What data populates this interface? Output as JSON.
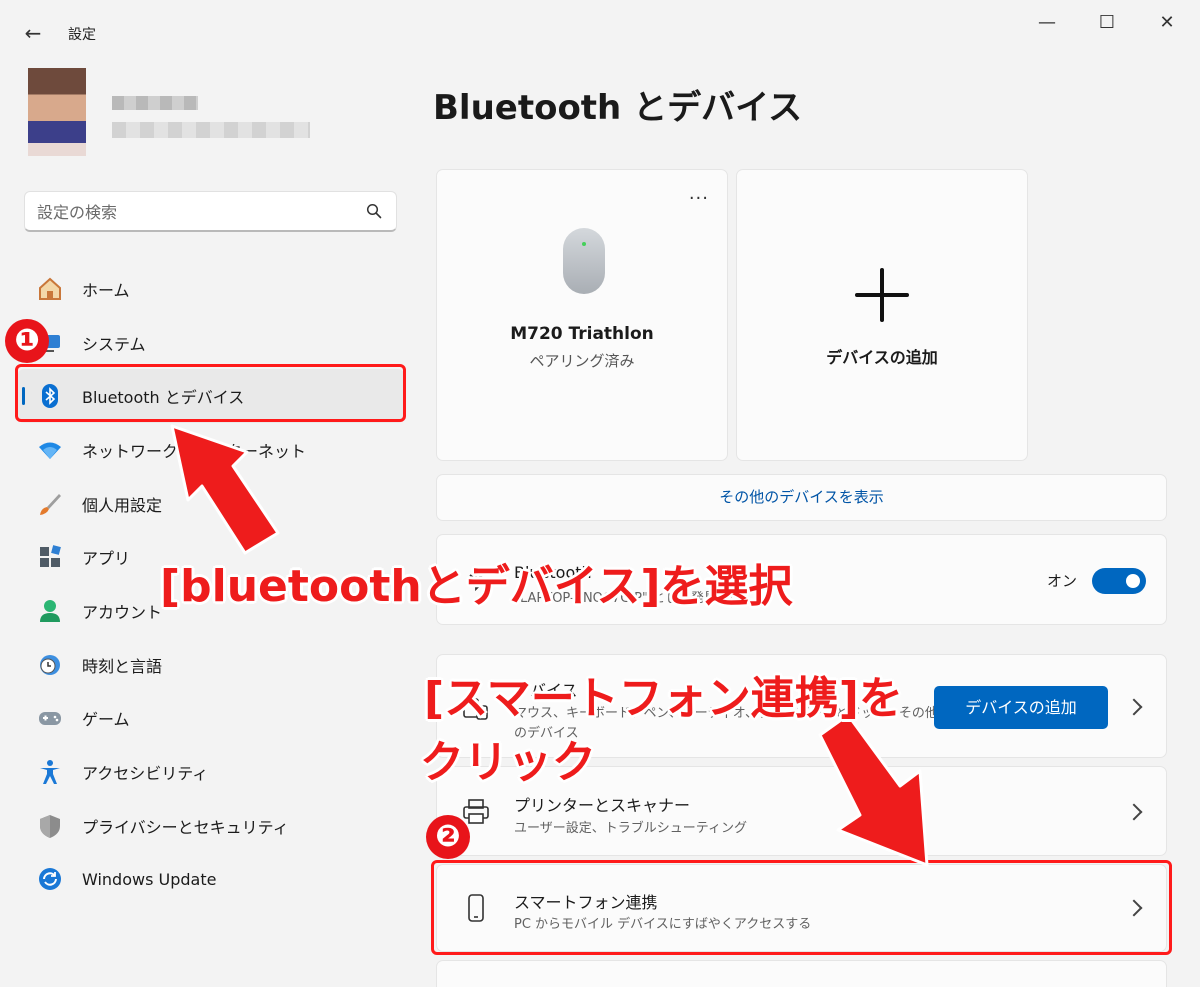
{
  "window": {
    "back_glyph": "←",
    "title": "設定",
    "minimize_glyph": "—",
    "maximize_glyph": "☐",
    "close_glyph": "✕"
  },
  "search": {
    "placeholder": "設定の検索"
  },
  "sidebar": {
    "items": [
      {
        "label": "ホーム",
        "icon": "home-icon"
      },
      {
        "label": "システム",
        "icon": "system-icon"
      },
      {
        "label": "Bluetooth とデバイス",
        "icon": "bluetooth-icon",
        "active": true
      },
      {
        "label": "ネットワークとインターネット",
        "icon": "wifi-icon"
      },
      {
        "label": "個人用設定",
        "icon": "brush-icon"
      },
      {
        "label": "アプリ",
        "icon": "apps-icon"
      },
      {
        "label": "アカウント",
        "icon": "account-icon"
      },
      {
        "label": "時刻と言語",
        "icon": "clock-globe-icon"
      },
      {
        "label": "ゲーム",
        "icon": "gamepad-icon"
      },
      {
        "label": "アクセシビリティ",
        "icon": "accessibility-icon"
      },
      {
        "label": "プライバシーとセキュリティ",
        "icon": "shield-icon"
      },
      {
        "label": "Windows Update",
        "icon": "update-icon"
      }
    ]
  },
  "main": {
    "title": "Bluetooth とデバイス",
    "device_card": {
      "more_glyph": "···",
      "name": "M720 Triathlon",
      "status": "ペアリング済み",
      "icon": "mouse-icon"
    },
    "add_card": {
      "label": "デバイスの追加",
      "icon": "plus-icon"
    },
    "show_more": "その他のデバイスを表示",
    "bluetooth_row": {
      "title": "Bluetooth",
      "desc": "\"LAPTOP-5NOC7GIP\" として発見可能",
      "toggle_label": "オン",
      "toggle_on": true
    },
    "devices_row": {
      "title": "デバイス",
      "desc_line1": "マウス、キーボード、ペン、オーディオ、ディスプレイとドック、その他",
      "desc_line2": "のデバイス",
      "button": "デバイスの追加"
    },
    "printers_row": {
      "title": "プリンターとスキャナー",
      "desc": "ユーザー設定、トラブルシューティング"
    },
    "phone_row": {
      "title": "スマートフォン連携",
      "desc": "PC からモバイル デバイスにすばやくアクセスする"
    }
  },
  "annotations": {
    "step1_number": "❶",
    "step2_number": "❷",
    "callout1": "[bluetoothとデバイス]を選択",
    "callout2_line1": "[スマートフォン連携]を",
    "callout2_line2": "クリック",
    "color": "#ee1c1c"
  },
  "colors": {
    "accent": "#0067c0",
    "background": "#f3f3f3",
    "card": "#fbfbfb"
  }
}
